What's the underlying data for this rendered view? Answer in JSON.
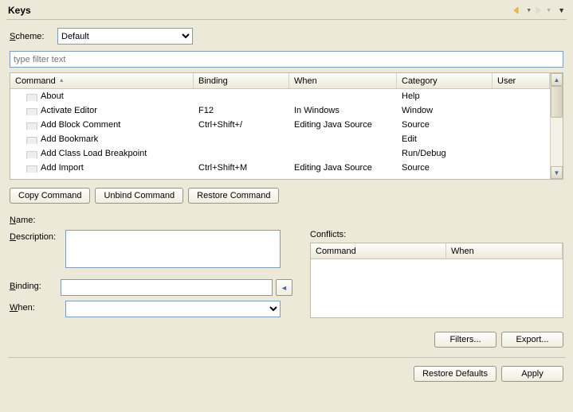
{
  "title": "Keys",
  "scheme": {
    "label": "Scheme:",
    "selected": "Default"
  },
  "filter": {
    "placeholder": "type filter text",
    "value": ""
  },
  "columns": {
    "command": "Command",
    "binding": "Binding",
    "when": "When",
    "category": "Category",
    "user": "User"
  },
  "rows": [
    {
      "command": "About",
      "binding": "",
      "when": "",
      "category": "Help"
    },
    {
      "command": "Activate Editor",
      "binding": "F12",
      "when": "In Windows",
      "category": "Window"
    },
    {
      "command": "Add Block Comment",
      "binding": "Ctrl+Shift+/",
      "when": "Editing Java Source",
      "category": "Source"
    },
    {
      "command": "Add Bookmark",
      "binding": "",
      "when": "",
      "category": "Edit"
    },
    {
      "command": "Add Class Load Breakpoint",
      "binding": "",
      "when": "",
      "category": "Run/Debug"
    },
    {
      "command": "Add Import",
      "binding": "Ctrl+Shift+M",
      "when": "Editing Java Source",
      "category": "Source"
    }
  ],
  "buttons": {
    "copy": "Copy Command",
    "unbind": "Unbind Command",
    "restore": "Restore Command",
    "filters": "Filters...",
    "export": "Export...",
    "restoreDefaults": "Restore Defaults",
    "apply": "Apply"
  },
  "fields": {
    "name": "Name:",
    "description": "Description:",
    "binding": "Binding:",
    "when": "When:",
    "conflicts": "Conflicts:"
  },
  "conflictsColumns": {
    "command": "Command",
    "when": "When"
  }
}
